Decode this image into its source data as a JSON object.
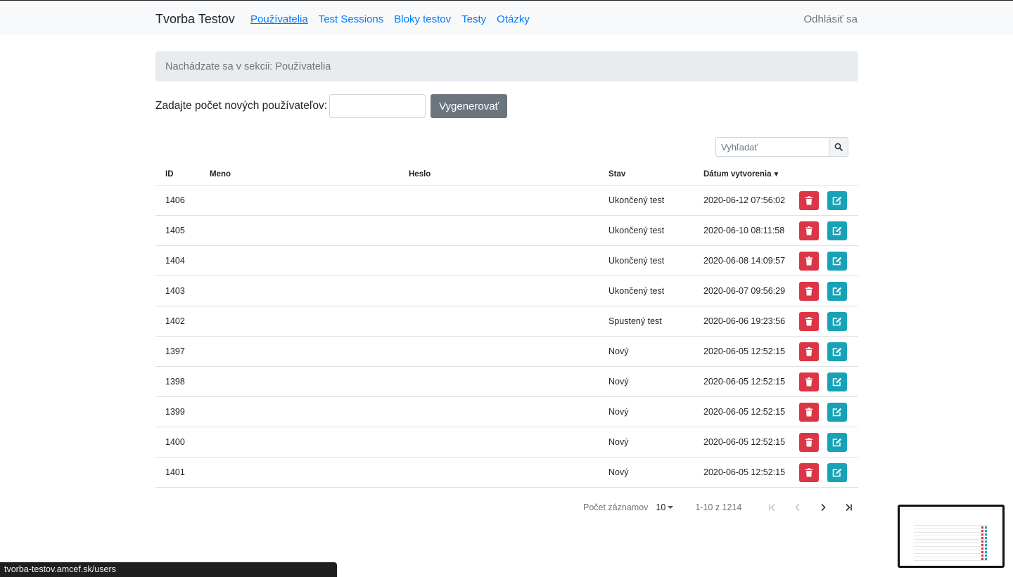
{
  "nav": {
    "brand": "Tvorba Testov",
    "links": [
      {
        "label": "Používatelia",
        "active": true
      },
      {
        "label": "Test Sessions",
        "active": false
      },
      {
        "label": "Bloky testov",
        "active": false
      },
      {
        "label": "Testy",
        "active": false
      },
      {
        "label": "Otázky",
        "active": false
      }
    ],
    "logout": "Odhlásiť sa"
  },
  "breadcrumb": "Nachádzate sa v sekcii: Používatelia",
  "generator": {
    "label": "Zadajte počet nových používateľov:",
    "input_value": "",
    "button": "Vygenerovať"
  },
  "search": {
    "placeholder": "Vyhľadať",
    "icon": "search-icon"
  },
  "table": {
    "columns": [
      "ID",
      "Meno",
      "Heslo",
      "Stav",
      "Dátum vytvorenia"
    ],
    "sort_indicator": "▼",
    "rows": [
      {
        "id": "1406",
        "meno": "",
        "heslo": "",
        "stav": "Ukončený test",
        "datum": "2020-06-12 07:56:02"
      },
      {
        "id": "1405",
        "meno": "",
        "heslo": "",
        "stav": "Ukončený test",
        "datum": "2020-06-10 08:11:58"
      },
      {
        "id": "1404",
        "meno": "",
        "heslo": "",
        "stav": "Ukončený test",
        "datum": "2020-06-08 14:09:57"
      },
      {
        "id": "1403",
        "meno": "",
        "heslo": "",
        "stav": "Ukončený test",
        "datum": "2020-06-07 09:56:29"
      },
      {
        "id": "1402",
        "meno": "",
        "heslo": "",
        "stav": "Spustený test",
        "datum": "2020-06-06 19:23:56"
      },
      {
        "id": "1397",
        "meno": "",
        "heslo": "",
        "stav": "Nový",
        "datum": "2020-06-05 12:52:15"
      },
      {
        "id": "1398",
        "meno": "",
        "heslo": "",
        "stav": "Nový",
        "datum": "2020-06-05 12:52:15"
      },
      {
        "id": "1399",
        "meno": "",
        "heslo": "",
        "stav": "Nový",
        "datum": "2020-06-05 12:52:15"
      },
      {
        "id": "1400",
        "meno": "",
        "heslo": "",
        "stav": "Nový",
        "datum": "2020-06-05 12:52:15"
      },
      {
        "id": "1401",
        "meno": "",
        "heslo": "",
        "stav": "Nový",
        "datum": "2020-06-05 12:52:15"
      }
    ],
    "row_actions": {
      "delete_icon": "trash-icon",
      "edit_icon": "edit-icon"
    }
  },
  "pagination": {
    "rows_per_page_label": "Počet záznamov",
    "rows_per_page": "10",
    "range": "1-10 z 1214"
  },
  "status_url": "tvorba-testov.amcef.sk/users",
  "colors": {
    "primary": "#007bff",
    "danger": "#dc3545",
    "info": "#17a2b8",
    "secondary": "#6c757d"
  }
}
